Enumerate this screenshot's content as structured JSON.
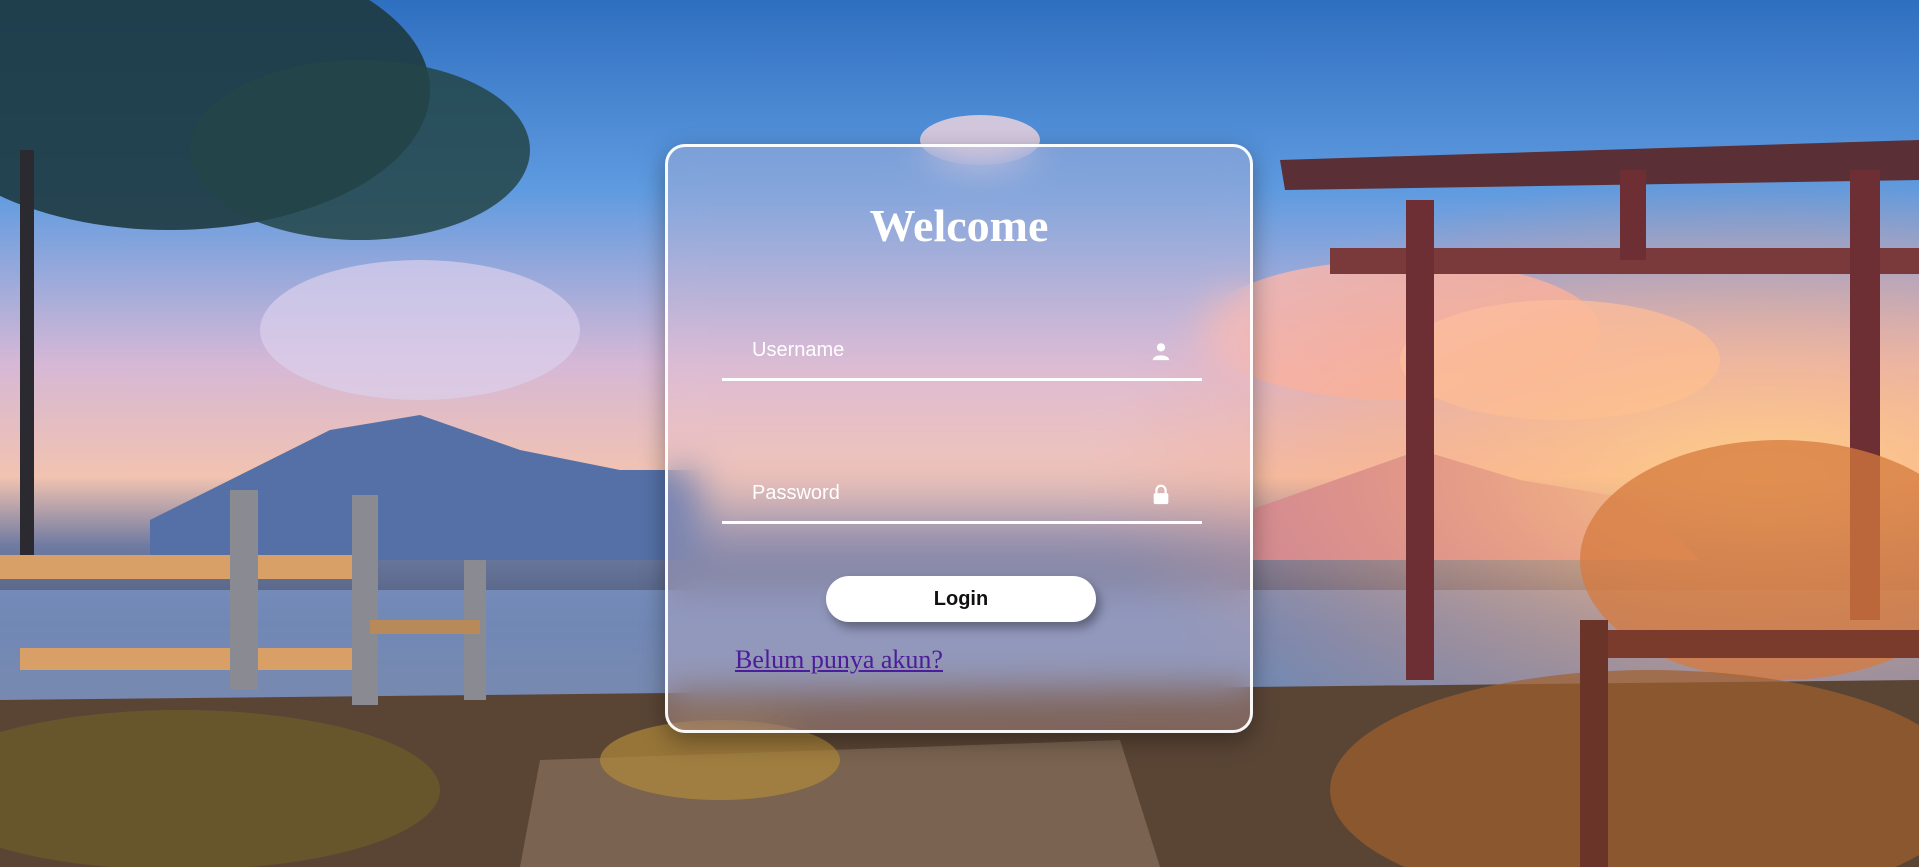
{
  "login": {
    "title": "Welcome",
    "username": {
      "placeholder": "Username",
      "value": "",
      "icon": "user-icon"
    },
    "password": {
      "placeholder": "Password",
      "value": "",
      "icon": "lock-icon"
    },
    "submit_label": "Login",
    "register_link": "Belum punya akun?"
  },
  "colors": {
    "card_border": "#ffffff",
    "button_bg": "#ffffff",
    "button_text": "#111111",
    "link": "#4b1d9a",
    "text": "#ffffff"
  }
}
